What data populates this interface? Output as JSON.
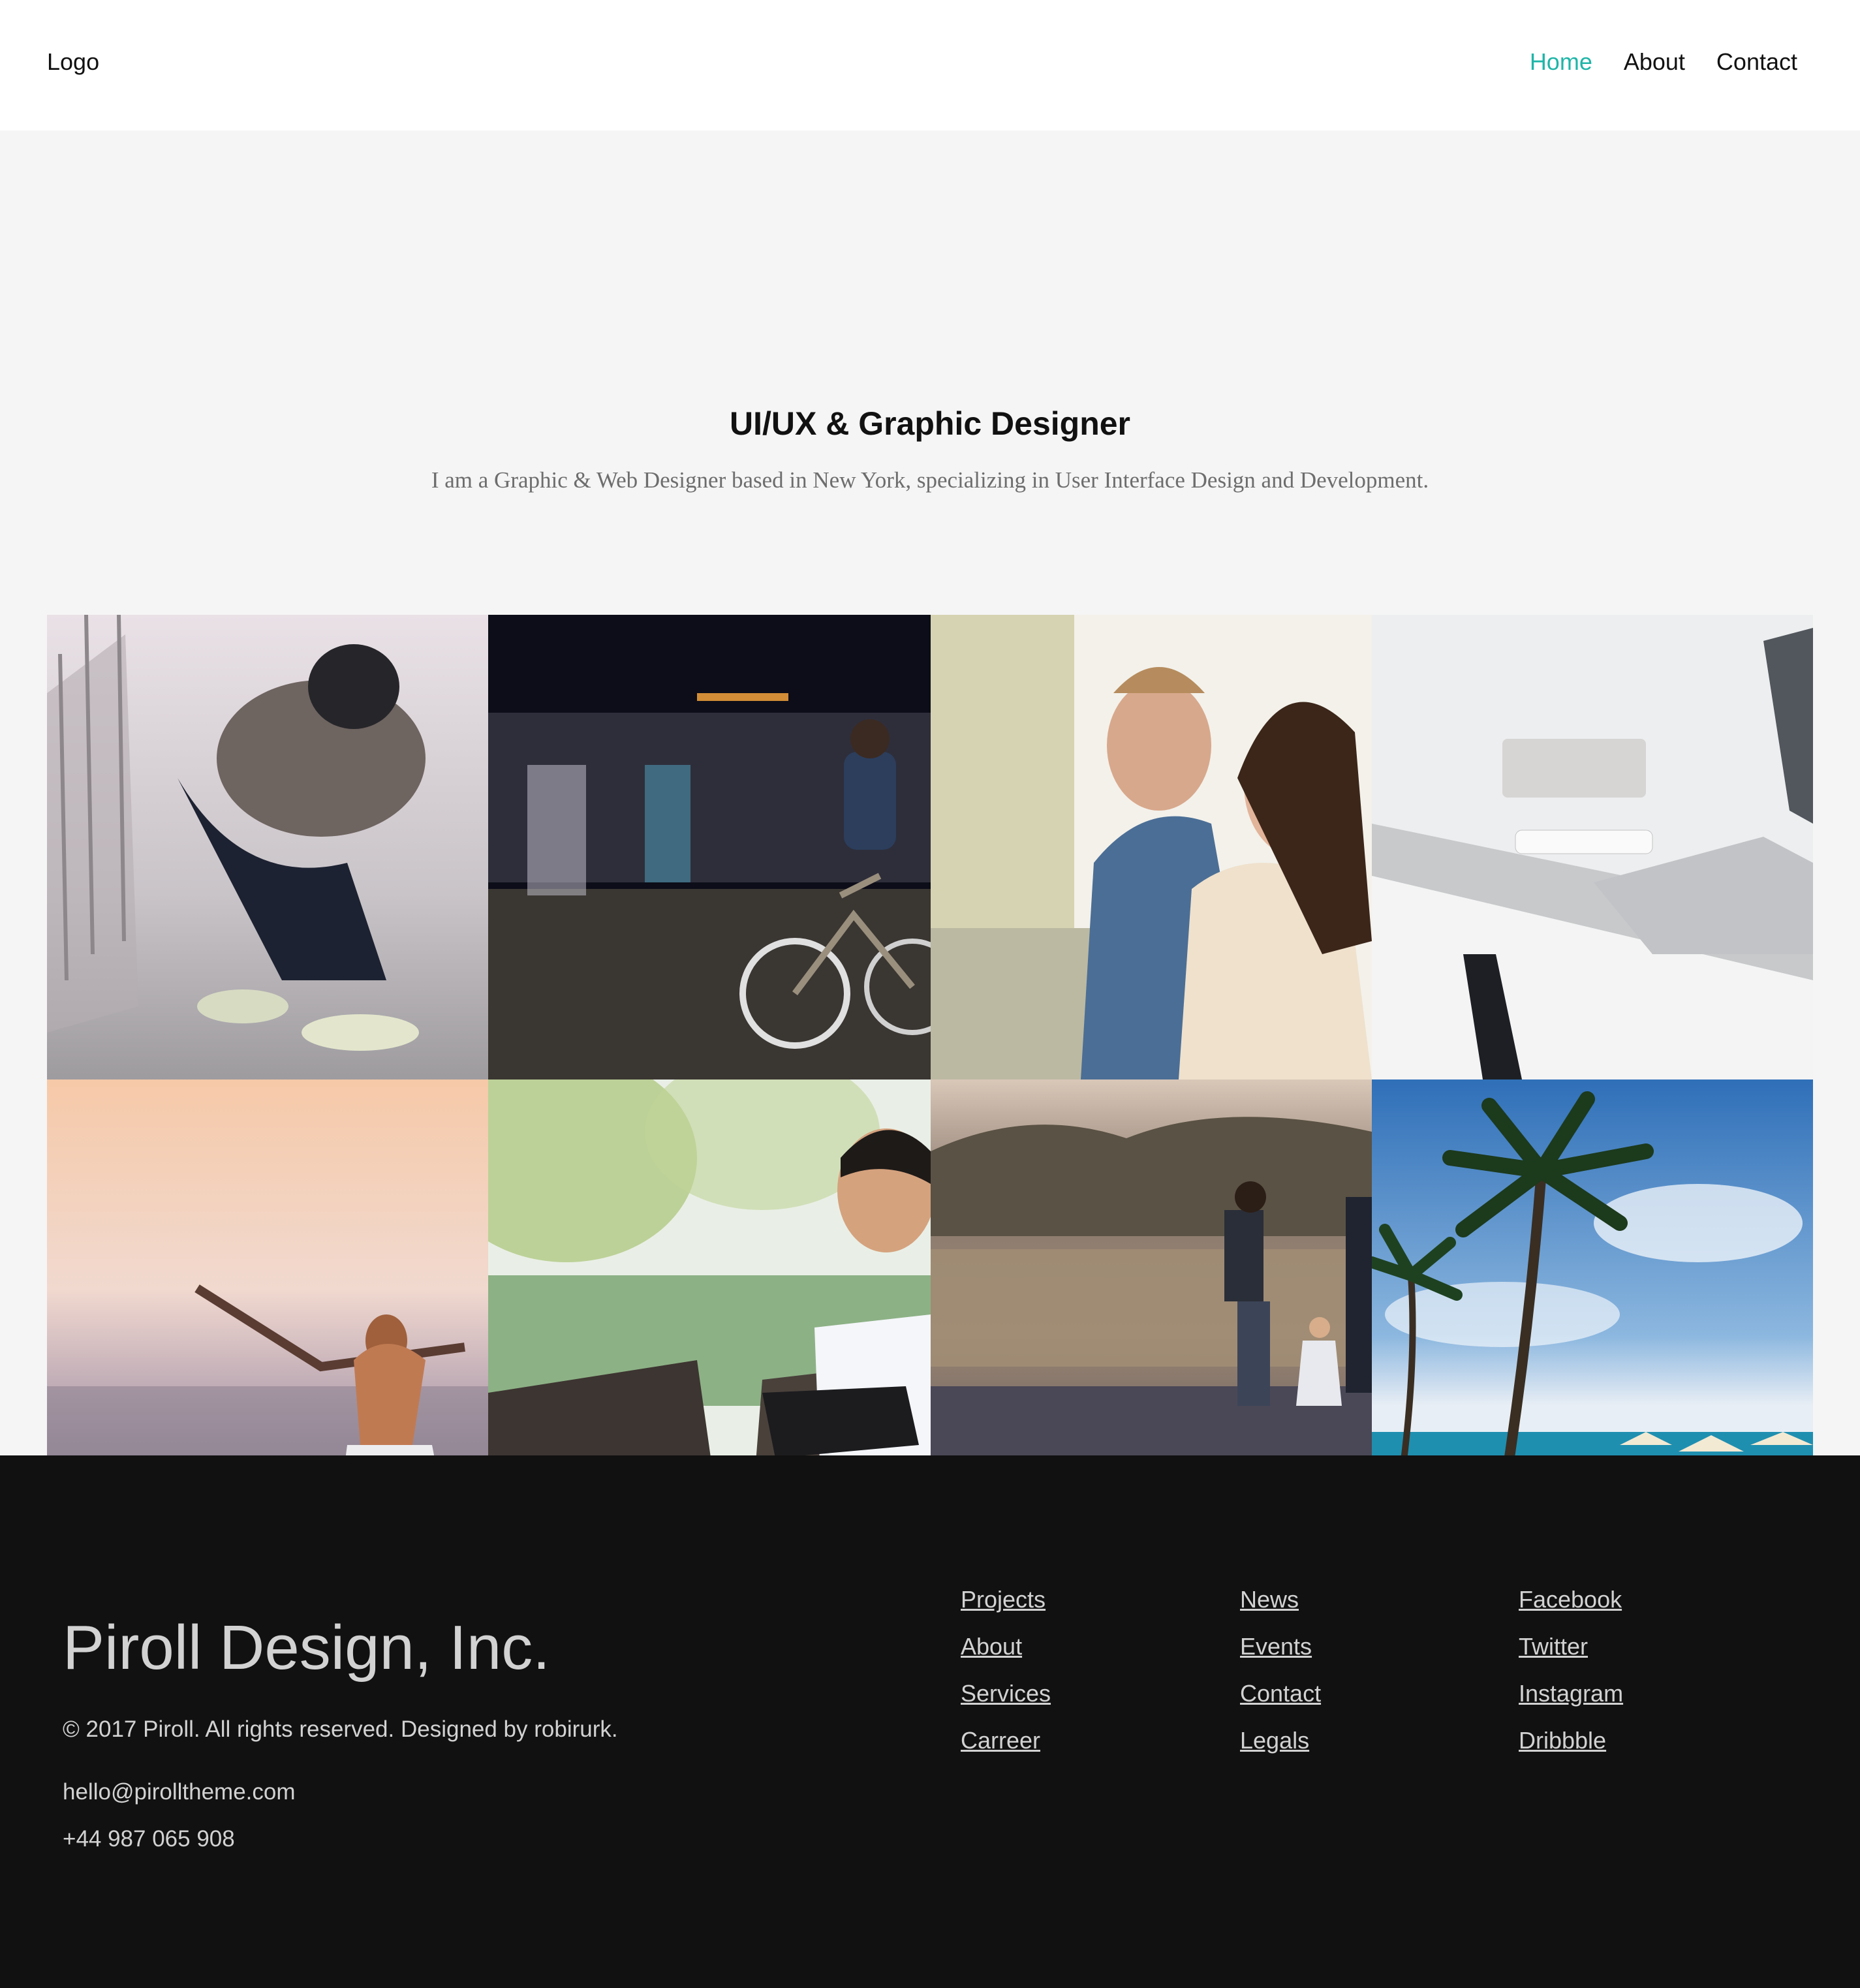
{
  "header": {
    "logo": "Logo",
    "nav": [
      {
        "label": "Home",
        "active": true
      },
      {
        "label": "About",
        "active": false
      },
      {
        "label": "Contact",
        "active": false
      }
    ],
    "accent_color": "#1fb5a8"
  },
  "hero": {
    "title": "UI/UX & Graphic Designer",
    "subtitle": "I am a Graphic & Web Designer based in New York, specializing in User Interface Design and Development."
  },
  "gallery": {
    "items": [
      {
        "icon": "photo-woman-tying-shoelaces"
      },
      {
        "icon": "photo-cyclist-motion-blur"
      },
      {
        "icon": "photo-smiling-couple"
      },
      {
        "icon": "photo-laptop-on-desk"
      },
      {
        "icon": "photo-woman-at-sunset-beach"
      },
      {
        "icon": "photo-man-with-tablet"
      },
      {
        "icon": "photo-family-walking-field"
      },
      {
        "icon": "photo-palm-trees-beach"
      }
    ]
  },
  "footer": {
    "brand": "Piroll Design, Inc.",
    "copyright": "© 2017 Piroll. All rights reserved. Designed by robirurk.",
    "email": "hello@pirolltheme.com",
    "phone": "+44 987 065 908",
    "columns": [
      [
        "Projects",
        "About",
        "Services",
        "Carreer"
      ],
      [
        "News",
        "Events",
        "Contact",
        "Legals"
      ],
      [
        "Facebook",
        "Twitter",
        "Instagram",
        "Dribbble"
      ]
    ],
    "background": "#111111"
  }
}
